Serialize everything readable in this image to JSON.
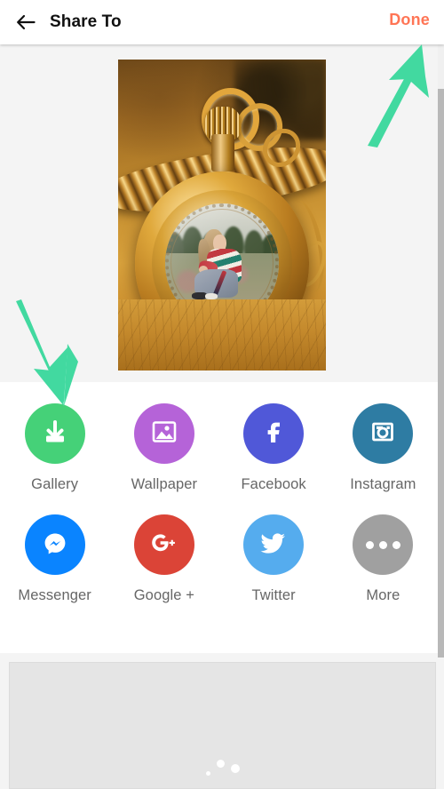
{
  "header": {
    "back_icon": "arrow-left-icon",
    "title": "Share To",
    "done_label": "Done",
    "done_color": "#ff7555"
  },
  "preview": {
    "image_alt": "edited photo: woman seated inside golden pocket watch on vintage map",
    "background_color": "#f4f4f4"
  },
  "share": {
    "rows": [
      [
        {
          "label": "Gallery",
          "icon": "download-icon",
          "color": "#45d178"
        },
        {
          "label": "Wallpaper",
          "icon": "image-icon",
          "color": "#b563d8"
        },
        {
          "label": "Facebook",
          "icon": "facebook-icon",
          "color": "#5058d8"
        },
        {
          "label": "Instagram",
          "icon": "instagram-icon",
          "color": "#2e7ca3"
        }
      ],
      [
        {
          "label": "Messenger",
          "icon": "messenger-icon",
          "color": "#0a84ff"
        },
        {
          "label": "Google +",
          "icon": "google-plus-icon",
          "color": "#db4437"
        },
        {
          "label": "Twitter",
          "icon": "twitter-icon",
          "color": "#55acee"
        },
        {
          "label": "More",
          "icon": "more-dots-icon",
          "color": "#a0a0a0"
        }
      ]
    ]
  },
  "ad": {
    "state": "loading",
    "loading_dots": 3,
    "background_color": "#e5e5e5"
  },
  "annotations": {
    "arrow_color": "#42d9a0",
    "arrows": [
      {
        "name": "arrow-pointing-to-done",
        "points_at": "Done"
      },
      {
        "name": "arrow-pointing-to-gallery",
        "points_at": "Gallery"
      }
    ]
  },
  "scrollbar": {
    "orientation": "vertical",
    "thumb_color": "#b8b8b8"
  }
}
